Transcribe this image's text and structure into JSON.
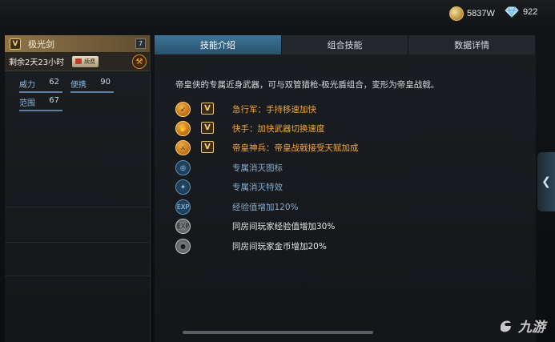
{
  "currency": {
    "gold_amount": "5837W",
    "diamond_amount": "922",
    "gold_icon": "gold-coin-icon",
    "diamond_icon": "diamond-icon"
  },
  "weapon": {
    "badge": "V",
    "name": "极光剑",
    "level": "7",
    "remaining": "剩余2天23小时",
    "renew_label": "续费"
  },
  "stats": [
    {
      "label": "威力",
      "value": "62"
    },
    {
      "label": "便携",
      "value": "90"
    },
    {
      "label": "范围",
      "value": "67"
    }
  ],
  "tabs": [
    {
      "label": "技能介绍",
      "active": true
    },
    {
      "label": "组合技能",
      "active": false
    },
    {
      "label": "数据详情",
      "active": false
    }
  ],
  "description": "帝皇侠的专属近身武器，可与双管猎枪-极光盾组合，变形为帝皇战戟。",
  "skills": [
    {
      "icon": "run-icon",
      "style": "orange",
      "vip": "V",
      "text": "急行军：手持移速加快"
    },
    {
      "icon": "hand-icon",
      "style": "orange",
      "vip": "V",
      "text": "快手：加快武器切换速度"
    },
    {
      "icon": "weapon-icon",
      "style": "orange",
      "vip": "V",
      "text": "帝皇神兵：帝皇战戟接受天赋加成"
    },
    {
      "icon": "target-icon",
      "style": "blue",
      "vip": "",
      "text": "专属消灭图标"
    },
    {
      "icon": "compass-icon",
      "style": "blue",
      "vip": "",
      "text": "专属消灭特效"
    },
    {
      "icon": "exp-icon",
      "style": "blue",
      "vip": "",
      "text": "经验值增加120%"
    },
    {
      "icon": "exp-icon",
      "style": "gray",
      "vip": "",
      "text": "同房间玩家经验值增加30%"
    },
    {
      "icon": "coin-icon",
      "style": "gray",
      "vip": "",
      "text": "同房间玩家金币增加20%"
    }
  ],
  "watermark": "九游",
  "colors": {
    "tab_active": "#3d7597",
    "skill_orange": "#f0a640",
    "skill_blue": "#86acd0",
    "gold": "#e9c56d"
  }
}
